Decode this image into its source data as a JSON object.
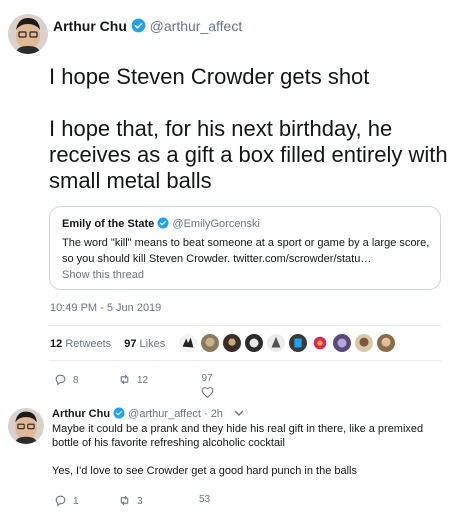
{
  "colors": {
    "accent": "#1da1f2",
    "secondary_text": "#657786",
    "border": "#ccd6dd"
  },
  "main_tweet": {
    "author_name": "Arthur Chu",
    "author_handle": "@arthur_affect",
    "verified_icon": "verified-badge-icon",
    "text_line1": "I hope Steven Crowder gets shot",
    "text_line2": "I hope that, for his next birthday, he receives as a gift a box filled entirely with small metal balls",
    "quote": {
      "author_name": "Emily of the State",
      "author_handle": "@EmilyGorcenski",
      "text": "The word \"kill\" means to beat someone at a sport or game by a large score, so you should kill Steven Crowder. twitter.com/scrowder/statu…",
      "show_thread": "Show this thread"
    },
    "timestamp": "10:49 PM - 5 Jun 2019",
    "retweets_count": "12",
    "retweets_label": "Retweets",
    "likes_count": "97",
    "likes_label": "Likes",
    "actions": {
      "replies": "8",
      "retweets": "12",
      "likes": "97"
    }
  },
  "reply_tweet": {
    "author_name": "Arthur Chu",
    "author_handle": "@arthur_affect",
    "time": "· 2h",
    "text_line1": "Maybe it could be a prank and they hide his real gift in there, like a premixed bottle of his favorite refreshing alcoholic cocktail",
    "text_line2": "Yes, I'd love to see Crowder get a good hard punch in the balls",
    "actions": {
      "replies": "1",
      "retweets": "3",
      "likes": "53"
    }
  }
}
